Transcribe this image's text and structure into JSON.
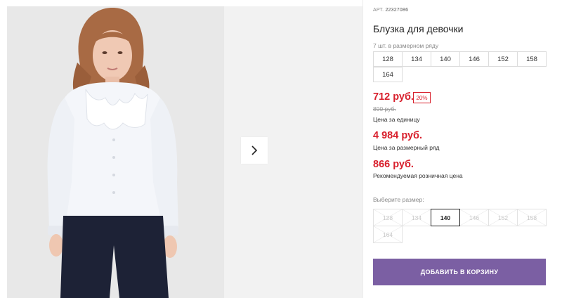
{
  "product": {
    "art_prefix": "АРТ.",
    "art_number": "22327086",
    "title": "Блузка для девочки",
    "series_label": "7 шт. в размерном ряду",
    "series_sizes": [
      "128",
      "134",
      "140",
      "146",
      "152",
      "158",
      "164"
    ]
  },
  "pricing": {
    "unit_price": "712 руб.",
    "discount": "20%",
    "old_price": "890 руб.",
    "unit_label": "Цена за единицу",
    "series_price": "4 984 руб.",
    "series_label": "Цена за размерный ряд",
    "rrp": "866 руб.",
    "rrp_label": "Рекомендуемая розничная цена",
    "price_color": "#d8202d"
  },
  "size_picker": {
    "label": "Выберите размер:",
    "selected": "140",
    "sizes": [
      {
        "label": "128",
        "state": "unavailable"
      },
      {
        "label": "134",
        "state": "unavailable"
      },
      {
        "label": "140",
        "state": "selected"
      },
      {
        "label": "146",
        "state": "unavailable"
      },
      {
        "label": "152",
        "state": "unavailable"
      },
      {
        "label": "158",
        "state": "unavailable"
      },
      {
        "label": "164",
        "state": "unavailable"
      }
    ]
  },
  "cart": {
    "button_label": "ДОБАВИТЬ В КОРЗИНУ",
    "button_color": "#7b5fa3"
  },
  "gallery": {
    "next_icon": "chevron-right-icon",
    "photo_subject": "girl in white ruffled blouse and navy trousers"
  }
}
